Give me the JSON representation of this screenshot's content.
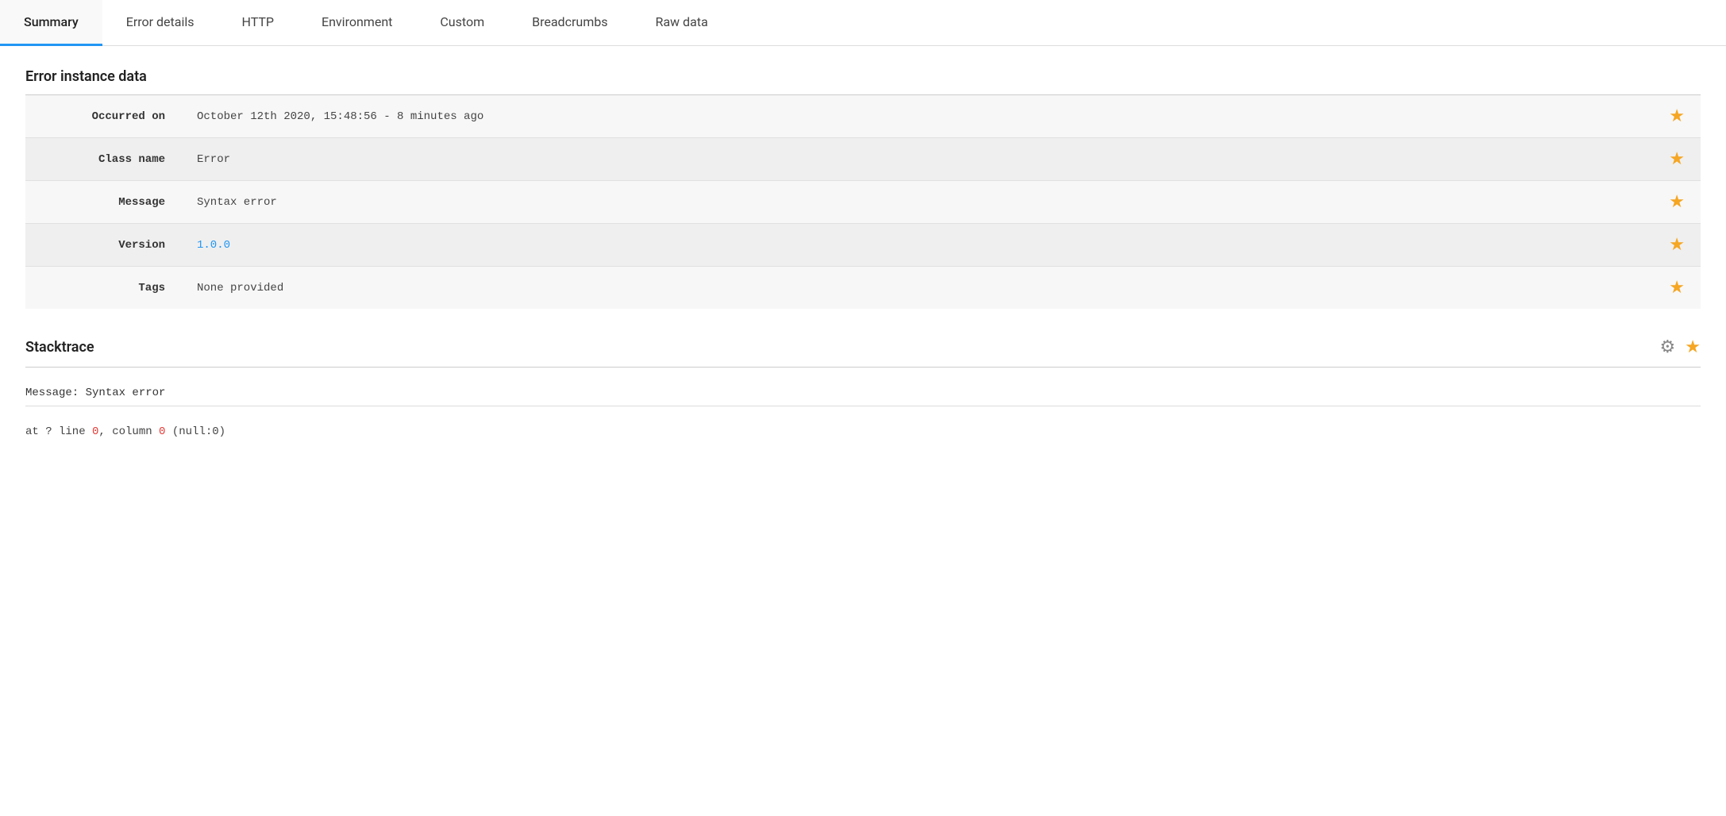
{
  "tabs": [
    {
      "label": "Summary",
      "active": true
    },
    {
      "label": "Error details",
      "active": false
    },
    {
      "label": "HTTP",
      "active": false
    },
    {
      "label": "Environment",
      "active": false
    },
    {
      "label": "Custom",
      "active": false
    },
    {
      "label": "Breadcrumbs",
      "active": false
    },
    {
      "label": "Raw data",
      "active": false
    }
  ],
  "error_instance": {
    "section_title": "Error instance data",
    "rows": [
      {
        "label": "Occurred on",
        "value": "October 12th 2020, 15:48:56 - 8 minutes ago",
        "is_link": false
      },
      {
        "label": "Class name",
        "value": "Error",
        "is_link": false
      },
      {
        "label": "Message",
        "value": "Syntax error",
        "is_link": false
      },
      {
        "label": "Version",
        "value": "1.0.0",
        "is_link": true
      },
      {
        "label": "Tags",
        "value": "None provided",
        "is_link": false
      }
    ]
  },
  "stacktrace": {
    "section_title": "Stacktrace",
    "message": "Message: Syntax error",
    "line": "at ? line ",
    "line_num1": "0",
    "line_middle": ", column ",
    "line_num2": "0",
    "line_end": " (null:0)"
  },
  "icons": {
    "star": "★",
    "gear": "⚙"
  }
}
